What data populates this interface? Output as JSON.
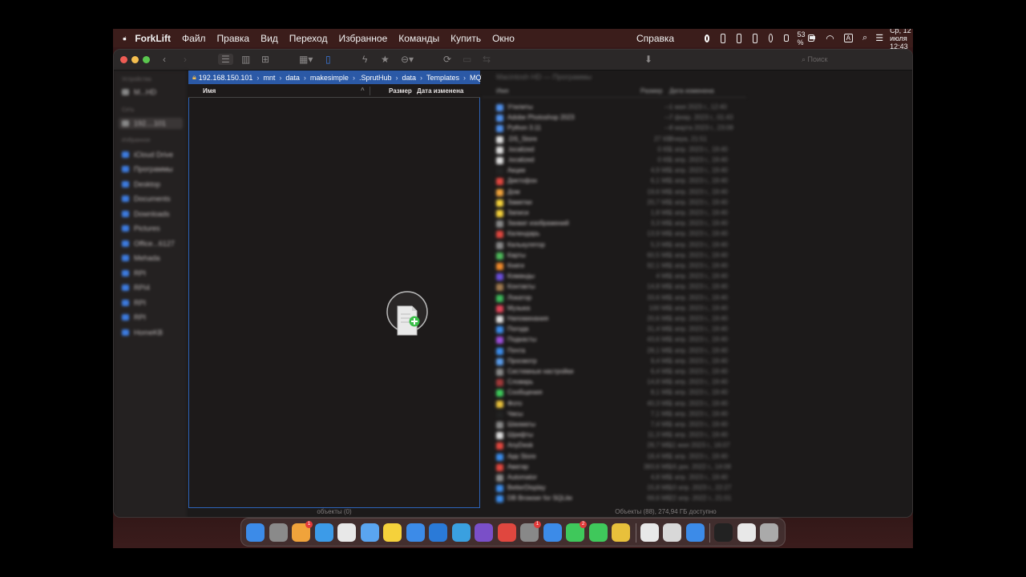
{
  "menubar": {
    "app_name": "ForkLift",
    "menus": [
      "Файл",
      "Правка",
      "Вид",
      "Переход",
      "Избранное",
      "Команды",
      "Купить",
      "Окно"
    ],
    "help": "Справка",
    "battery": "53 %",
    "input_source": "A",
    "datetime": "Ср, 12 июля  12:43"
  },
  "toolbar": {
    "search_placeholder": "Поиск"
  },
  "sidebar": {
    "sections": [
      {
        "header": "Устройства",
        "items": [
          "M...HD"
        ]
      },
      {
        "header": "Сеть",
        "items": [
          "192....101"
        ]
      },
      {
        "header": "Избранное",
        "items": [
          "iCloud Drive",
          "Программы",
          "Desktop",
          "Documents",
          "Downloads",
          "Pictures",
          "Office...6127",
          "Mehada",
          "RPI",
          "RPI4",
          "RPI",
          "RPI",
          "HomeKB"
        ]
      }
    ]
  },
  "left_pane": {
    "path": [
      "192.168.150.101",
      "mnt",
      "data",
      "makesimple",
      ".SprutHub",
      "data",
      "Templates",
      "MQTT"
    ],
    "columns": {
      "name": "Имя",
      "size": "Размер",
      "date": "Дата изменена"
    },
    "status": "объекты (0)"
  },
  "right_pane": {
    "path": "Macintosh HD — Программы",
    "columns": {
      "name": "Имя",
      "size": "Размер",
      "date": "Дата изменена"
    },
    "rows": [
      {
        "name": "Утилиты",
        "size": "—",
        "date": "1 мая 2023 г., 12:40",
        "color": "#4f8ee8"
      },
      {
        "name": "Adobe Photoshop 2023",
        "size": "—",
        "date": "7 февр. 2023 г., 01:43",
        "color": "#4f8ee8"
      },
      {
        "name": "Python 3.11",
        "size": "—",
        "date": "8 марта 2023 г., 23:08",
        "color": "#4f8ee8"
      },
      {
        "name": ".DS_Store",
        "size": "27 КБ",
        "date": "Вчера, 21:51",
        "color": "#dcdcdc"
      },
      {
        "name": ".localized",
        "size": "0 КБ",
        "date": "1 апр. 2023 г., 19:40",
        "color": "#dcdcdc"
      },
      {
        "name": ".localized",
        "size": "0 КБ",
        "date": "1 апр. 2023 г., 19:40",
        "color": "#dcdcdc"
      },
      {
        "name": "Акции",
        "size": "4,9 МБ",
        "date": "1 апр. 2023 г., 19:40",
        "color": "#222"
      },
      {
        "name": "Диктофон",
        "size": "6,1 МБ",
        "date": "1 апр. 2023 г., 19:40",
        "color": "#e0473f"
      },
      {
        "name": "Дом",
        "size": "19,6 МБ",
        "date": "1 апр. 2023 г., 19:40",
        "color": "#f0a33b"
      },
      {
        "name": "Заметки",
        "size": "20,7 МБ",
        "date": "1 апр. 2023 г., 19:40",
        "color": "#f5d13b"
      },
      {
        "name": "Записи",
        "size": "1,8 МБ",
        "date": "1 апр. 2023 г., 19:40",
        "color": "#f5d13b"
      },
      {
        "name": "Захват изображений",
        "size": "3,3 МБ",
        "date": "1 апр. 2023 г., 19:40",
        "color": "#888"
      },
      {
        "name": "Календарь",
        "size": "13,9 МБ",
        "date": "1 апр. 2023 г., 19:40",
        "color": "#e0473f"
      },
      {
        "name": "Калькулятор",
        "size": "5,3 МБ",
        "date": "1 апр. 2023 г., 19:40",
        "color": "#888"
      },
      {
        "name": "Карты",
        "size": "60,5 МБ",
        "date": "1 апр. 2023 г., 19:40",
        "color": "#4fb85b"
      },
      {
        "name": "Книги",
        "size": "92,1 МБ",
        "date": "1 апр. 2023 г., 19:40",
        "color": "#f08a2b"
      },
      {
        "name": "Команды",
        "size": "4 МБ",
        "date": "1 апр. 2023 г., 19:40",
        "color": "#6a4fd8"
      },
      {
        "name": "Контакты",
        "size": "14,8 МБ",
        "date": "1 апр. 2023 г., 19:40",
        "color": "#a07a50"
      },
      {
        "name": "Локатор",
        "size": "33,6 МБ",
        "date": "1 апр. 2023 г., 19:40",
        "color": "#3fb85b"
      },
      {
        "name": "Музыка",
        "size": "100 МБ",
        "date": "1 апр. 2023 г., 19:40",
        "color": "#e04558"
      },
      {
        "name": "Напоминания",
        "size": "20,6 МБ",
        "date": "1 апр. 2023 г., 19:40",
        "color": "#dcdcdc"
      },
      {
        "name": "Погода",
        "size": "31,4 МБ",
        "date": "1 апр. 2023 г., 19:40",
        "color": "#3c8be8"
      },
      {
        "name": "Подкасты",
        "size": "43,6 МБ",
        "date": "1 апр. 2023 г., 19:40",
        "color": "#9b4fd8"
      },
      {
        "name": "Почта",
        "size": "28,1 МБ",
        "date": "1 апр. 2023 г., 19:40",
        "color": "#3c8be8"
      },
      {
        "name": "Просмотр",
        "size": "9,4 МБ",
        "date": "1 апр. 2023 г., 19:40",
        "color": "#5a9be8"
      },
      {
        "name": "Системные настройки",
        "size": "6,4 МБ",
        "date": "1 апр. 2023 г., 19:40",
        "color": "#888"
      },
      {
        "name": "Словарь",
        "size": "14,8 МБ",
        "date": "1 апр. 2023 г., 19:40",
        "color": "#a03a3a"
      },
      {
        "name": "Сообщения",
        "size": "8,1 МБ",
        "date": "1 апр. 2023 г., 19:40",
        "color": "#3fc85b"
      },
      {
        "name": "Фото",
        "size": "40,3 МБ",
        "date": "1 апр. 2023 г., 19:40",
        "color": "#e8c03b"
      },
      {
        "name": "Часы",
        "size": "7,1 МБ",
        "date": "1 апр. 2023 г., 19:40",
        "color": "#222"
      },
      {
        "name": "Шахматы",
        "size": "7,4 МБ",
        "date": "1 апр. 2023 г., 19:40",
        "color": "#888"
      },
      {
        "name": "Шрифты",
        "size": "11,3 МБ",
        "date": "1 апр. 2023 г., 19:40",
        "color": "#dcdcdc"
      },
      {
        "name": "AnyDesk",
        "size": "28,7 МБ",
        "date": "11 мая 2023 г., 16:07",
        "color": "#e0473f"
      },
      {
        "name": "App Store",
        "size": "18,4 МБ",
        "date": "1 апр. 2023 г., 19:40",
        "color": "#3c8be8"
      },
      {
        "name": "Аватар",
        "size": "383,6 МБ",
        "date": "16 дек. 2022 г., 14:08",
        "color": "#e0473f"
      },
      {
        "name": "Automator",
        "size": "4,8 МБ",
        "date": "1 апр. 2023 г., 19:40",
        "color": "#888"
      },
      {
        "name": "BetterDisplay",
        "size": "15,8 МБ",
        "date": "10 апр. 2023 г., 22:27",
        "color": "#3c8be8"
      },
      {
        "name": "DB Browser for SQLite",
        "size": "69,6 МБ",
        "date": "22 апр. 2022 г., 21:01",
        "color": "#3c8be8"
      }
    ],
    "status": "Объекты (88), 274,94 ГБ доступно"
  },
  "dock": {
    "apps": [
      {
        "name": "finder",
        "color": "#3c8be8"
      },
      {
        "name": "launchpad",
        "color": "#8a8a8a"
      },
      {
        "name": "home",
        "color": "#f0a33b",
        "badge": "1"
      },
      {
        "name": "safari",
        "color": "#3c9be8"
      },
      {
        "name": "yandex-browser",
        "color": "#e8e8e8"
      },
      {
        "name": "mail",
        "color": "#5aa5f0"
      },
      {
        "name": "notes",
        "color": "#f5d13b"
      },
      {
        "name": "app-store",
        "color": "#3c8be8"
      },
      {
        "name": "vscode",
        "color": "#2a7ad8"
      },
      {
        "name": "telegram",
        "color": "#3aa0e0"
      },
      {
        "name": "github-desktop",
        "color": "#7a4fc8"
      },
      {
        "name": "anydesk",
        "color": "#e0473f"
      },
      {
        "name": "system-settings",
        "color": "#888",
        "badge": "1"
      },
      {
        "name": "activity-monitor",
        "color": "#3c8be8"
      },
      {
        "name": "facetime",
        "color": "#3fc85b",
        "badge": "2"
      },
      {
        "name": "messages",
        "color": "#3fc85b"
      },
      {
        "name": "forklift",
        "color": "#e8c03b"
      },
      {
        "name": "reminders",
        "color": "#e8e8e8"
      },
      {
        "name": "preview",
        "color": "#d8d8d8"
      },
      {
        "name": "proxyman",
        "color": "#3c8be8"
      },
      {
        "name": "terminal",
        "color": "#222"
      },
      {
        "name": "document",
        "color": "#e8e8e8"
      },
      {
        "name": "trash",
        "color": "#aaa"
      }
    ]
  }
}
